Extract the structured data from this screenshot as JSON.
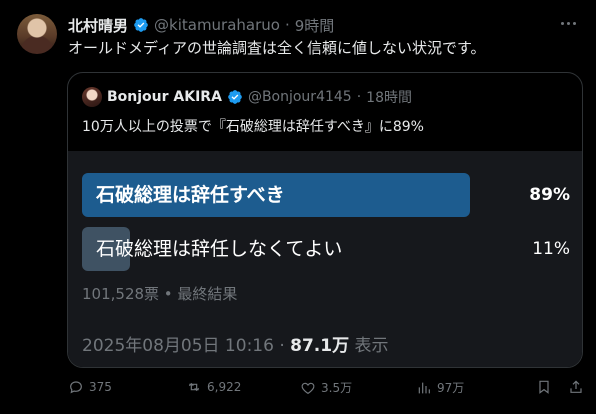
{
  "tweet": {
    "author_name": "北村晴男",
    "handle": "@kitamuraharuo",
    "time": "9時間",
    "text": "オールドメディアの世論調査は全く信頼に値しない状況です。"
  },
  "quote": {
    "author_name": "Bonjour AKIRA",
    "handle": "@Bonjour4145",
    "time": "18時間",
    "text": "10万人以上の投票で『石破総理は辞任すべき』に89%",
    "poll": {
      "options": [
        {
          "label": "石破総理は辞任すべき",
          "percent_text": "89%",
          "fraction": 0.89
        },
        {
          "label": "石破総理は辞任しなくてよい",
          "percent_text": "11%",
          "fraction": 0.11
        }
      ],
      "summary": "101,528票 • 最終結果"
    },
    "timestamp": "2025年08月05日 10:16 · ",
    "views_count": "87.1万",
    "views_label": " 表示"
  },
  "actions": {
    "replies": "375",
    "reposts": "6,922",
    "likes": "3.5万",
    "views": "97万"
  },
  "colors": {
    "background": "#000000",
    "poll_winner": "#1d5c8f",
    "poll_other": "#3f5263",
    "verified": "#1d9bf0"
  }
}
